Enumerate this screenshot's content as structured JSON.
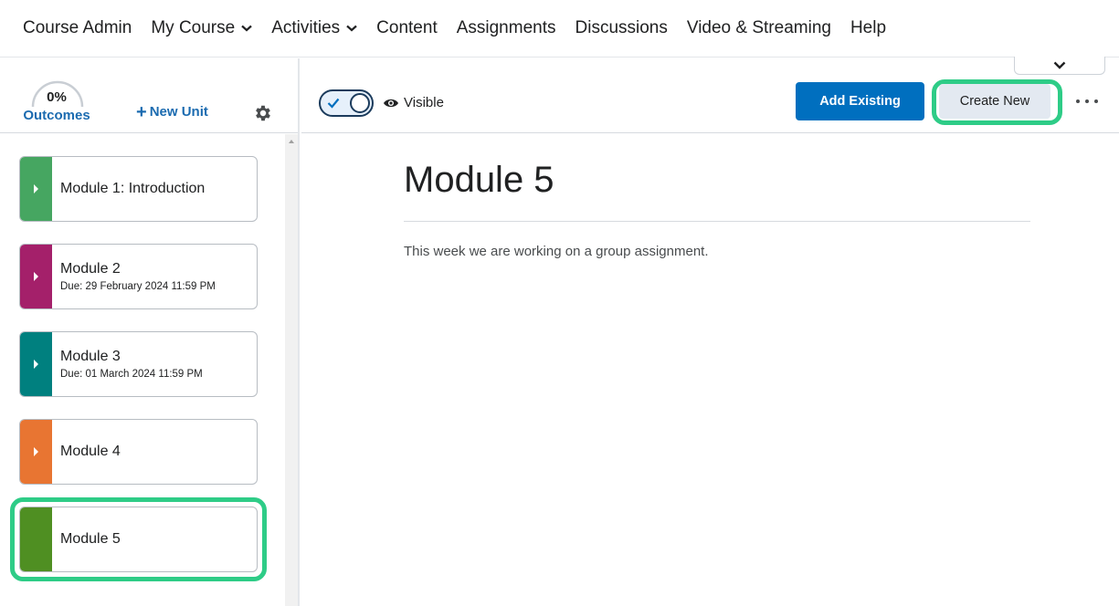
{
  "nav": {
    "items": [
      {
        "label": "Course Admin",
        "dropdown": false
      },
      {
        "label": "My Course",
        "dropdown": true
      },
      {
        "label": "Activities",
        "dropdown": true
      },
      {
        "label": "Content",
        "dropdown": false
      },
      {
        "label": "Assignments",
        "dropdown": false
      },
      {
        "label": "Discussions",
        "dropdown": false
      },
      {
        "label": "Video & Streaming",
        "dropdown": false
      },
      {
        "label": "Help",
        "dropdown": false
      }
    ]
  },
  "sidebar": {
    "outcomes_percent": "0%",
    "outcomes_progress": 0,
    "outcomes_label": "Outcomes",
    "new_unit_label": "New Unit",
    "modules": [
      {
        "title": "Module 1: Introduction",
        "due": "",
        "color": "#46a661"
      },
      {
        "title": "Module 2",
        "due": "Due: 29 February 2024 11:59 PM",
        "color": "#a4206a"
      },
      {
        "title": "Module 3",
        "due": "Due: 01 March 2024 11:59 PM",
        "color": "#00807f"
      },
      {
        "title": "Module 4",
        "due": "",
        "color": "#e87532"
      },
      {
        "title": "Module 5",
        "due": "",
        "color": "#4f8f22",
        "selected": true
      }
    ]
  },
  "toolbar": {
    "visibility_label": "Visible",
    "add_existing_label": "Add Existing",
    "create_new_label": "Create New"
  },
  "content": {
    "title": "Module 5",
    "description": "This week we are working on a group assignment."
  },
  "colors": {
    "accent": "#006fbf",
    "link": "#1b6bb0",
    "highlight": "#2ecc87"
  }
}
